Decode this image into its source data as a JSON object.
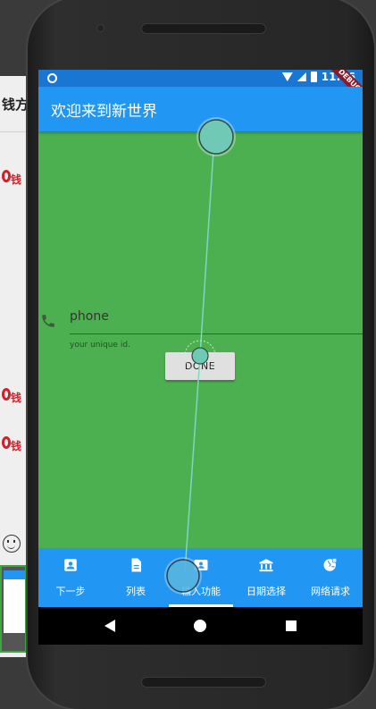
{
  "background_app": {
    "title": "钱方",
    "logo_text": "钱"
  },
  "status_bar": {
    "time": "11:16",
    "debug_label": "DEBUG"
  },
  "app_bar": {
    "title": "欢迎来到新世界"
  },
  "form": {
    "phone_label": "phone",
    "helper_text": "your unique id.",
    "done_button": "DONE"
  },
  "bottom_nav": {
    "items": [
      {
        "label": "下一步",
        "icon": "contact-card-icon"
      },
      {
        "label": "列表",
        "icon": "document-icon"
      },
      {
        "label": "输入功能",
        "icon": "contacts-icon"
      },
      {
        "label": "日期选择",
        "icon": "bank-icon"
      },
      {
        "label": "网络请求",
        "icon": "globe-icon"
      }
    ],
    "active_index": 2
  },
  "colors": {
    "primary": "#2196f3",
    "status_bar": "#1976d2",
    "body": "#4caf50",
    "touch": "#7fd6c2"
  }
}
